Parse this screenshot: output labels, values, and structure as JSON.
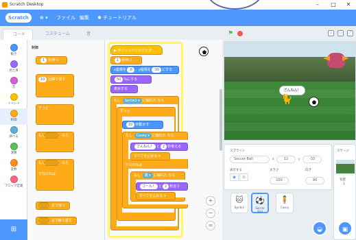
{
  "window": {
    "title": "Scratch Desktop",
    "controls": [
      "–",
      "□",
      "✕"
    ]
  },
  "menu": {
    "logo": "Scratch",
    "globe": "⊕ ▾",
    "file": "ファイル",
    "edit": "編集",
    "tutorial": "チュートリアル"
  },
  "tabs": {
    "code": "コード",
    "costumes": "コスチューム",
    "sounds": "音"
  },
  "categories": [
    {
      "label": "動き",
      "color": "#4c97ff"
    },
    {
      "label": "見た目",
      "color": "#9966ff"
    },
    {
      "label": "音",
      "color": "#cf63cf"
    },
    {
      "label": "イベント",
      "color": "#ffbf00"
    },
    {
      "label": "制御",
      "color": "#ffab19"
    },
    {
      "label": "調べる",
      "color": "#5cb1d6"
    },
    {
      "label": "演算",
      "color": "#59c059"
    },
    {
      "label": "変数",
      "color": "#ff8c1a"
    },
    {
      "label": "ブロック定義",
      "color": "#ff6680"
    }
  ],
  "palette": {
    "heading": "制御",
    "wait": {
      "num": "1",
      "text": "秒待つ"
    },
    "repeat": {
      "num": "10",
      "text": "回繰り返す"
    },
    "forever": "ずっと",
    "if": "もし",
    "then": "なら",
    "else": "でなければ",
    "wait_until": "まで待つ",
    "repeat_until": "まで繰り返す"
  },
  "script": {
    "hat": "▶ がクリックされたとき",
    "wait1": {
      "num": "1",
      "text": "秒待つ"
    },
    "goto": {
      "a": "x座標を",
      "x": "-6",
      "b": "、y座標を",
      "y": "-30",
      "c": "にする"
    },
    "size": {
      "num": "50",
      "text": "%にする"
    },
    "show": "表示する",
    "if1": {
      "pre": "もし",
      "dd": "Sprite1 ▾",
      "mid": "に触れた",
      "post": "なら"
    },
    "forever": "ずっと",
    "move": {
      "num": "10",
      "text": "歩動かす"
    },
    "if2": {
      "pre": "もし",
      "dd": "Casey ▾",
      "mid": "に触れた",
      "post": "なら"
    },
    "say1": {
      "txt": "ざんねん！",
      "mid": "と",
      "num": "2",
      "post": "秒考える"
    },
    "stop1": "すべてを止める ▾",
    "else": "でなければ",
    "if3": {
      "pre": "もし",
      "dd": "端 ▾",
      "mid": "に触れた",
      "post": "なら"
    },
    "say2": {
      "txt": "ゴール！",
      "mid": "と",
      "num": "2",
      "post": "秒言う"
    },
    "stop2": "すべてを止める ▾"
  },
  "zoom": {
    "in": "+",
    "out": "−",
    "reset": "="
  },
  "stage": {
    "bubble": "ざんねん！"
  },
  "sprite_info": {
    "sprite_label": "スプライト",
    "sprite_name": "Soccer Ball",
    "x_label": "x",
    "x": "12",
    "y_label": "y",
    "y": "-33",
    "show_label": "表示する",
    "size_label": "大きさ",
    "size": "100",
    "dir_label": "向き",
    "dir": "90"
  },
  "sprites": [
    {
      "name": "Sprite1",
      "thumb": "🐱"
    },
    {
      "name": "Soccer Ball",
      "thumb": "⚽"
    },
    {
      "name": "Casey",
      "thumb": "🧍"
    }
  ],
  "stage_panel": {
    "label": "ステージ",
    "bg_label": "背景",
    "bg_count": "1"
  }
}
